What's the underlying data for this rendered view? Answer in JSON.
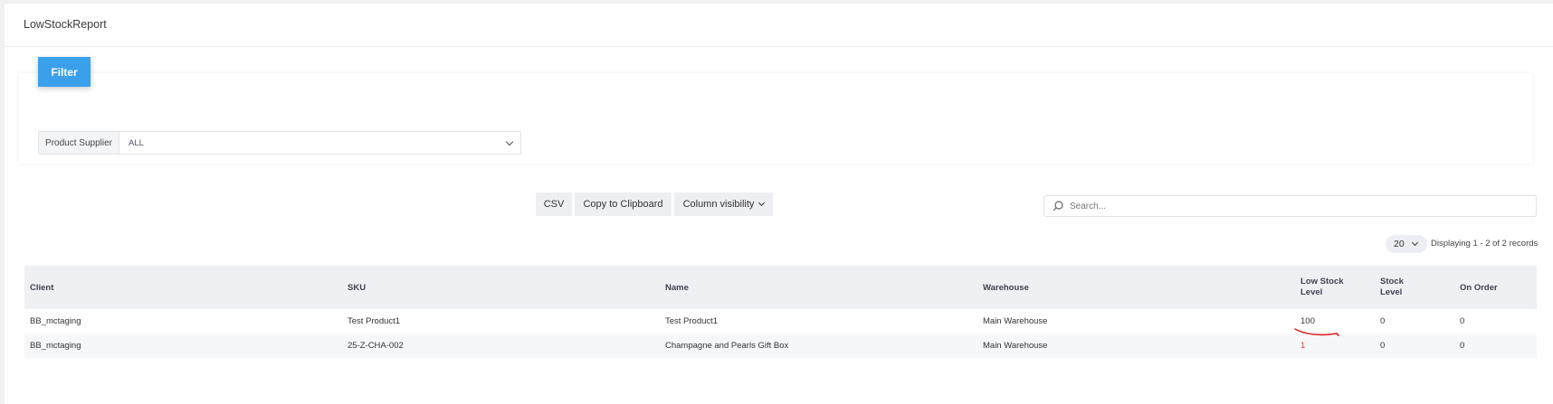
{
  "page": {
    "title": "LowStockReport"
  },
  "filter": {
    "button_label": "Filter",
    "supplier_label": "Product Supplier",
    "supplier_value": "ALL"
  },
  "toolbar": {
    "csv_label": "CSV",
    "copy_label": "Copy to Clipboard",
    "colvis_label": "Column visibility"
  },
  "search": {
    "placeholder": "Search..."
  },
  "pagination": {
    "page_size": "20",
    "info": "Displaying 1 - 2 of 2 records"
  },
  "table": {
    "headers": {
      "client": "Client",
      "sku": "SKU",
      "name": "Name",
      "warehouse": "Warehouse",
      "low_stock_1": "Low Stock",
      "low_stock_2": "Level",
      "stock_1": "Stock",
      "stock_2": "Level",
      "on_order": "On Order"
    },
    "rows": [
      {
        "client": "BB_mctaging",
        "sku": "Test Product1",
        "name": "Test Product1",
        "warehouse": "Main Warehouse",
        "low_stock": "100",
        "stock": "0",
        "on_order": "0"
      },
      {
        "client": "BB_mctaging",
        "sku": "25-Z-CHA-002",
        "name": "Champagne and Pearls Gift Box",
        "warehouse": "Main Warehouse",
        "low_stock": "1",
        "stock": "0",
        "on_order": "0"
      }
    ]
  },
  "colors": {
    "accent": "#3aa0ec",
    "low_stock_alert": "#e03a3a",
    "annotation": "#e02020"
  },
  "icons": {
    "search": "search-icon",
    "chevron": "chevron-down-icon"
  }
}
